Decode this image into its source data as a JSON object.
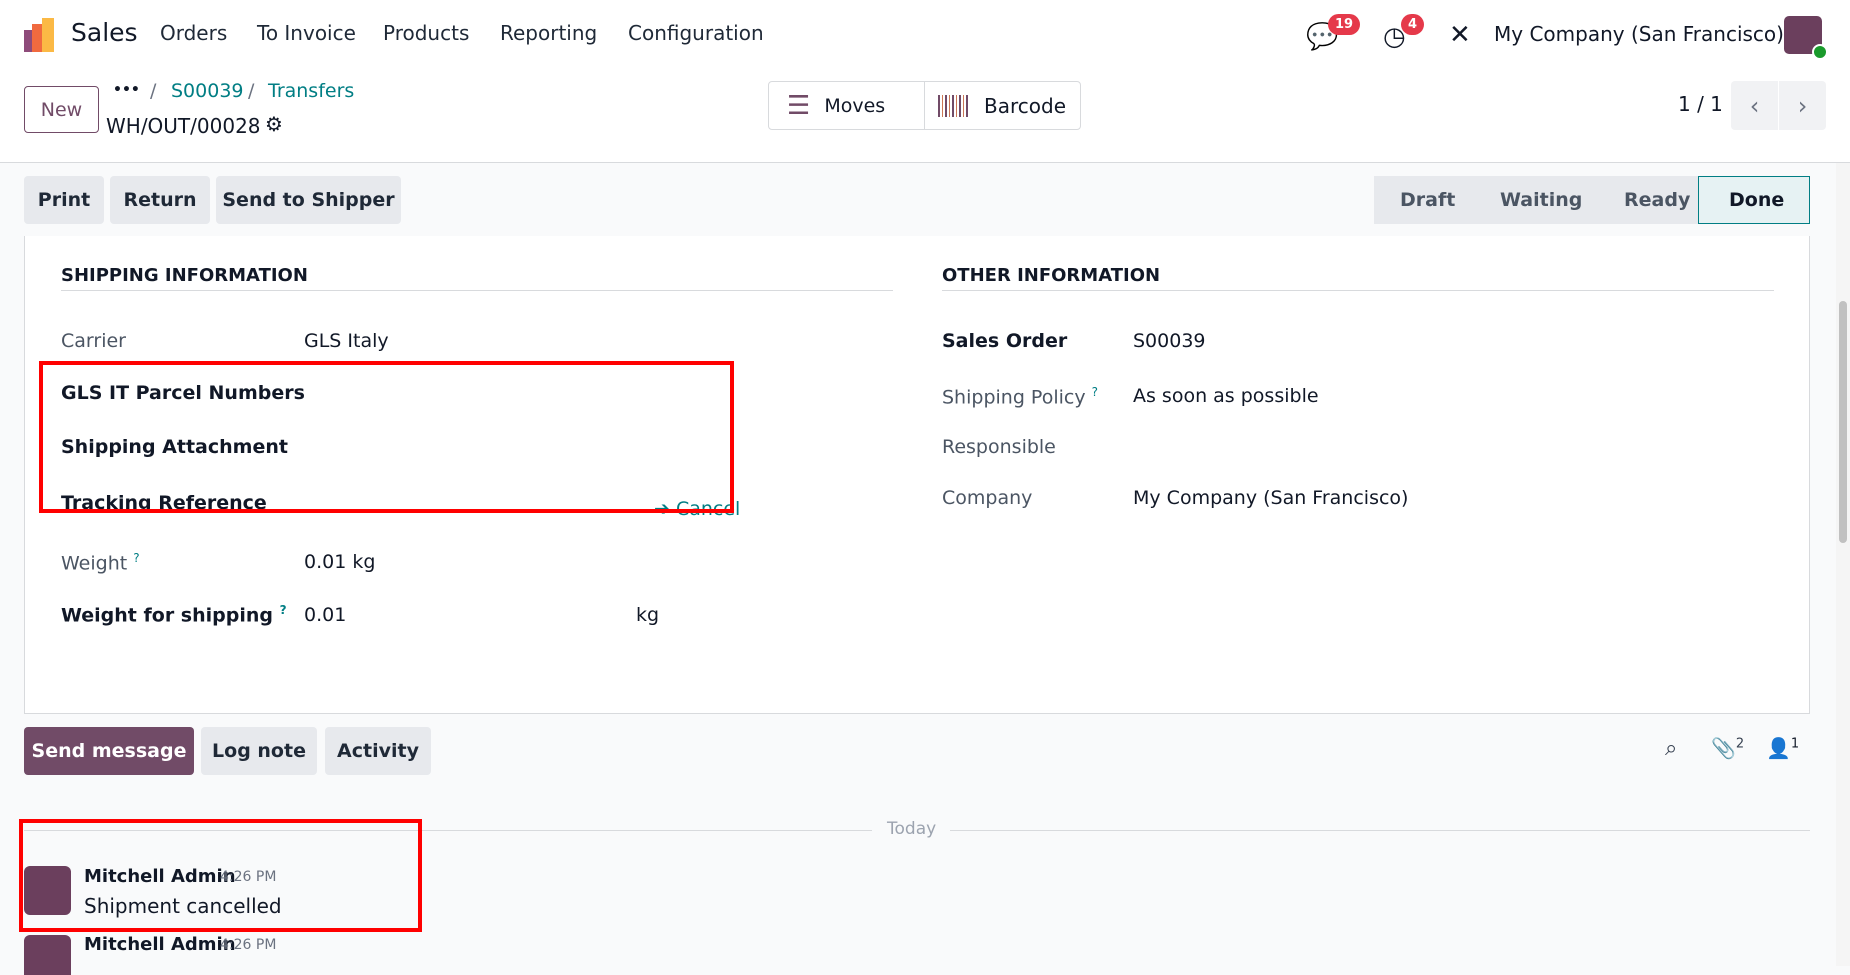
{
  "nav": {
    "app": "Sales",
    "menu": [
      "Orders",
      "To Invoice",
      "Products",
      "Reporting",
      "Configuration"
    ],
    "messages_count": "19",
    "activities_count": "4",
    "company": "My Company (San Francisco)"
  },
  "control": {
    "new_label": "New",
    "breadcrumb_more": "•••",
    "breadcrumb": [
      "S00039",
      "Transfers"
    ],
    "record": "WH/OUT/00028",
    "moves_label": "Moves",
    "barcode_label": "Barcode",
    "pager": "1 / 1"
  },
  "actions": [
    "Print",
    "Return",
    "Send to Shipper"
  ],
  "statusbar": {
    "steps": [
      "Draft",
      "Waiting",
      "Ready",
      "Done"
    ],
    "active": "Done"
  },
  "shipping": {
    "title": "SHIPPING INFORMATION",
    "carrier_label": "Carrier",
    "carrier": "GLS Italy",
    "parcel_label": "GLS IT Parcel Numbers",
    "attachment_label": "Shipping Attachment",
    "tracking_label": "Tracking Reference",
    "cancel_label": "Cancel",
    "weight_label": "Weight",
    "weight": "0.01",
    "weight_unit": "kg",
    "ship_weight_label": "Weight for shipping",
    "ship_weight": "0.01",
    "ship_weight_unit": "kg",
    "help": "?"
  },
  "other": {
    "title": "OTHER INFORMATION",
    "sales_order_label": "Sales Order",
    "sales_order": "S00039",
    "policy_label": "Shipping Policy",
    "policy": "As soon as possible",
    "responsible_label": "Responsible",
    "company_label": "Company",
    "company": "My Company (San Francisco)"
  },
  "chatter": {
    "send_message": "Send message",
    "log_note": "Log note",
    "activity": "Activity",
    "attachments_count": "2",
    "followers_count": "1",
    "today": "Today",
    "messages": [
      {
        "author": "Mitchell Admin",
        "time": "4:26 PM",
        "body": "Shipment cancelled"
      },
      {
        "author": "Mitchell Admin",
        "time": "4:26 PM"
      }
    ]
  },
  "colors": {
    "primary": "#714b67",
    "link": "#017e84",
    "highlight": "#ff0000"
  }
}
